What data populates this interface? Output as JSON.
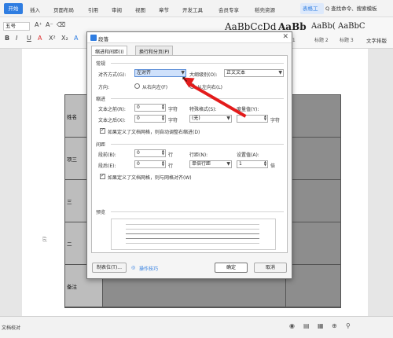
{
  "menu": {
    "start": "开始",
    "items": [
      "插入",
      "页面布局",
      "引用",
      "审阅",
      "视图",
      "章节",
      "开发工具",
      "会员专享",
      "稻壳资源"
    ],
    "active_tool": "表格工",
    "search": "Q 查找命令、搜索模板"
  },
  "toolbar": {
    "font_size": "五号",
    "styles": [
      "AaBbCcDd",
      "AaBb",
      "AaBb(",
      "AaBbC"
    ],
    "style_labels": [
      "正文",
      "标题 1",
      "标题 2",
      "标题 3"
    ],
    "text_tool": "文字排版"
  },
  "document": {
    "rows": [
      "姓名",
      "项三",
      "三",
      "二",
      "备注"
    ]
  },
  "dialog": {
    "title": "段落",
    "close": "✕",
    "tabs": [
      "缩进和间距(I)",
      "换行和分页(P)"
    ],
    "sections": {
      "general": "常规",
      "indent": "缩进",
      "spacing": "间距",
      "preview": "预览"
    },
    "align_label": "对齐方式(G):",
    "align_value": "左对齐",
    "outline_label": "大纲级别(O):",
    "outline_value": "正文文本",
    "direction_label": "方向:",
    "direction_rtl": "从右向左(F)",
    "direction_ltr": "从左向右(L)",
    "before_text_label": "文本之前(R):",
    "before_text_value": "0",
    "after_text_label": "文本之后(X):",
    "after_text_value": "0",
    "unit_char": "字符",
    "special_label": "特殊格式(S):",
    "special_value": "(无)",
    "measure_label": "度量值(Y):",
    "grid_indent_check": "如果定义了文档网格，则自动调整右缩进(D)",
    "before_para_label": "段前(B):",
    "before_para_value": "0",
    "after_para_label": "段后(E):",
    "after_para_value": "0",
    "unit_line": "行",
    "line_spacing_label": "行距(N):",
    "line_spacing_value": "单倍行距",
    "set_value_label": "设置值(A):",
    "set_value_value": "1",
    "unit_times": "倍",
    "grid_align_check": "如果定义了文档网格，则与网格对齐(W)",
    "tabs_button": "制表位(T)...",
    "tips_link": "操作技巧",
    "ok": "确定",
    "cancel": "取消"
  },
  "status": {
    "text": "文档校对"
  },
  "colors": {
    "accent": "#2f7de1",
    "annotation_arrow": "#e31b1b"
  }
}
